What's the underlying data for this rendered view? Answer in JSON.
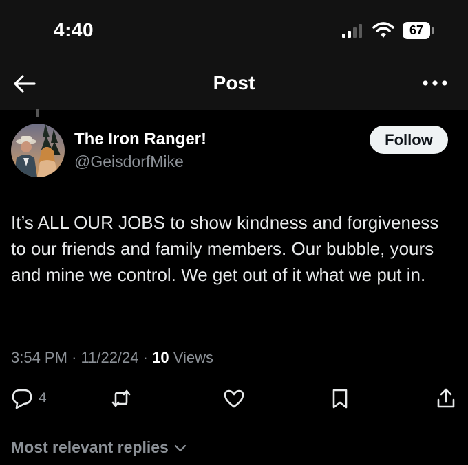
{
  "status_bar": {
    "time": "4:40",
    "battery": "67",
    "icons": [
      "signal-icon",
      "wifi-icon",
      "battery-icon"
    ]
  },
  "header": {
    "title": "Post",
    "back_icon": "arrow-left-icon",
    "more_icon": "more-dots-icon"
  },
  "author": {
    "name": "The Iron Ranger!",
    "handle": "@GeisdorfMike",
    "follow_label": "Follow"
  },
  "post": {
    "text": "It’s ALL OUR JOBS to show kindness and forgiveness to our friends and family members. Our bubble, yours and mine we control. We get out of it what we put in.",
    "time": "3:54 PM",
    "date": "11/22/24",
    "views_count": "10",
    "views_label": "Views"
  },
  "actions": {
    "reply_count": "4",
    "icons": [
      "reply-icon",
      "repost-icon",
      "like-icon",
      "bookmark-icon",
      "share-icon"
    ]
  },
  "replies": {
    "sort_label": "Most relevant replies"
  },
  "colors": {
    "background": "#000000",
    "header_background": "#121212",
    "text_primary": "#e7e9ea",
    "text_secondary": "#8b9096",
    "follow_button_bg": "#eff3f4"
  }
}
